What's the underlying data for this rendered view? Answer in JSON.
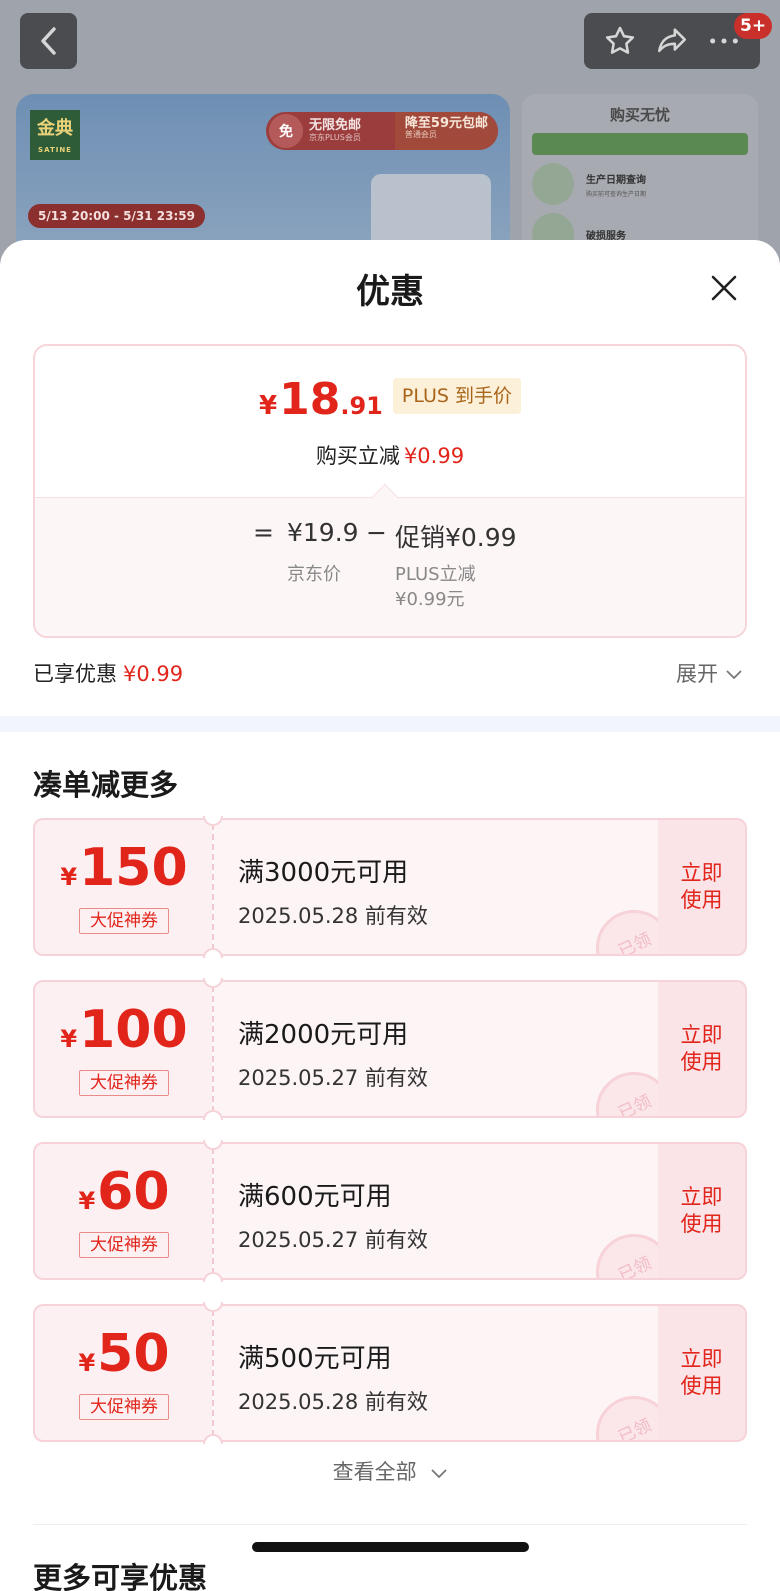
{
  "background": {
    "nav_badge": "5+",
    "brand_logo": "金典",
    "brand_logo_en": "SATINE",
    "shipping_pill_icon": "免",
    "shipping_pill_main": "无限免邮",
    "shipping_pill_main_sub": "京东PLUS会员",
    "shipping_pill_alt": "降至59元包邮",
    "shipping_pill_alt_sub": "普通会员",
    "promo_date": "5/13 20:00 - 5/31 23:59",
    "side_title": "购买无忧",
    "side_rows": [
      {
        "title": "生产日期查询",
        "desc": "购买前可查询生产日期"
      },
      {
        "title": "破损服务",
        "desc": ""
      }
    ]
  },
  "sheet": {
    "title": "优惠"
  },
  "price_card": {
    "currency": "¥",
    "price_int": "18",
    "price_dec": ".91",
    "tag": "PLUS 到手价",
    "sub_label": "购买立减",
    "sub_value": "¥0.99",
    "eq_sign": "=",
    "base_price": "¥19.9",
    "base_label": "京东价",
    "minus_sign": "−",
    "promo_text": "促销¥0.99",
    "promo_label_line1": "PLUS立减",
    "promo_label_line2": "¥0.99元"
  },
  "enjoyed": {
    "label": "已享优惠",
    "value": "¥0.99",
    "expand_label": "展开"
  },
  "coupons_section": {
    "title": "凑单减更多",
    "coupons": [
      {
        "currency": "¥",
        "amount": "150",
        "label": "大促神券",
        "condition": "满3000元可用",
        "validity": "2025.05.28 前有效",
        "action": "立即使用",
        "stamp": "已领"
      },
      {
        "currency": "¥",
        "amount": "100",
        "label": "大促神券",
        "condition": "满2000元可用",
        "validity": "2025.05.27 前有效",
        "action": "立即使用",
        "stamp": "已领"
      },
      {
        "currency": "¥",
        "amount": "60",
        "label": "大促神券",
        "condition": "满600元可用",
        "validity": "2025.05.27 前有效",
        "action": "立即使用",
        "stamp": "已领"
      },
      {
        "currency": "¥",
        "amount": "50",
        "label": "大促神券",
        "condition": "满500元可用",
        "validity": "2025.05.28 前有效",
        "action": "立即使用",
        "stamp": "已领"
      }
    ],
    "view_all": "查看全部"
  },
  "more_section": {
    "title": "更多可享优惠"
  },
  "colors": {
    "accent_red": "#e1251b",
    "plus_tag_bg": "#fdf0d8",
    "plus_tag_text": "#a8651a",
    "coupon_bg": "#fdf0f2"
  }
}
